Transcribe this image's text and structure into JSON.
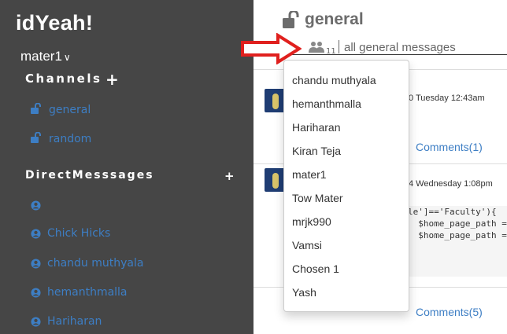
{
  "sidebar": {
    "workspace_name": "idYeah!",
    "username": "mater1",
    "username_chevron": "∨",
    "channels_heading": "Channels",
    "add_channel": "+",
    "channels": [
      {
        "label": "general"
      },
      {
        "label": "random"
      }
    ],
    "dm_heading": "DirectMesssages",
    "add_dm": "+",
    "direct_messages": [
      {
        "label": ""
      },
      {
        "label": "Chick Hicks"
      },
      {
        "label": "chandu muthyala"
      },
      {
        "label": "hemanthmalla"
      },
      {
        "label": "Hariharan"
      }
    ]
  },
  "channel_header": {
    "title": "general",
    "member_count": "11",
    "purpose": "all general messages",
    "star_icon": "star-icon",
    "members_icon": "users-icon"
  },
  "messages": [
    {
      "time": "0 Tuesday 12:43am",
      "comments": "Comments(1)"
    },
    {
      "time": "4 Wednesday 1:08pm",
      "code_lines": [
        "le']=='Faculty'){",
        "  $home_page_path =",
        "",
        "  $home_page_path ="
      ],
      "comments": "Comments(5)"
    }
  ],
  "members_dropdown": [
    "chandu muthyala",
    "hemanthmalla",
    "Hariharan",
    "Kiran Teja",
    "mater1",
    "Tow Mater",
    "mrjk990",
    "Vamsi",
    "Chosen 1",
    "Yash"
  ],
  "colors": {
    "sidebar_bg": "#464646",
    "link": "#3d7ec4",
    "star": "#f0ad4e",
    "arrow": "#e0201e"
  }
}
